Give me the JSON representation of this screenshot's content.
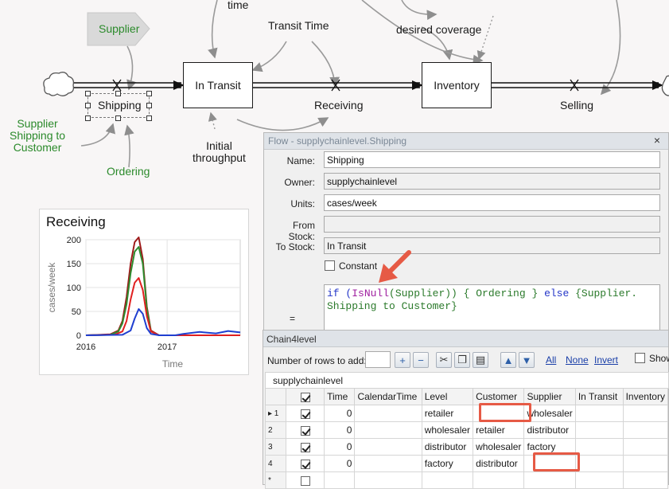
{
  "diagram": {
    "labels": {
      "time": "time",
      "transit_time": "Transit Time",
      "desired_coverage": "desired coverage",
      "supplier": "Supplier",
      "shipping": "Shipping",
      "supplier_shipping_to_customer": [
        "Supplier",
        "Shipping to",
        "Customer"
      ],
      "ordering": "Ordering",
      "initial_throughput": [
        "Initial",
        "throughput"
      ],
      "receiving": "Receiving",
      "selling": "Selling"
    },
    "stocks": {
      "in_transit": "In Transit",
      "inventory": "Inventory"
    }
  },
  "chart_panel": {
    "title": "Receiving"
  },
  "chart_data": {
    "type": "line",
    "title": "Receiving",
    "xlabel": "Time",
    "ylabel": "cases/week",
    "xlim": [
      2016,
      2017.9
    ],
    "ylim": [
      0,
      200
    ],
    "y_ticks": [
      0,
      50,
      100,
      150,
      200
    ],
    "x_ticks": [
      2016,
      2017
    ],
    "grid": true,
    "series": [
      {
        "color": "#9e1a1a",
        "x": [
          2016,
          2016.3,
          2016.4,
          2016.45,
          2016.5,
          2016.55,
          2016.6,
          2016.65,
          2016.7,
          2016.75,
          2016.8,
          2016.9,
          2017.9
        ],
        "y": [
          0,
          2,
          10,
          30,
          80,
          150,
          195,
          205,
          160,
          60,
          10,
          0,
          0
        ]
      },
      {
        "color": "#2e8b2e",
        "x": [
          2016,
          2016.3,
          2016.4,
          2016.45,
          2016.5,
          2016.55,
          2016.6,
          2016.65,
          2016.7,
          2016.75,
          2016.8,
          2016.9,
          2017.9
        ],
        "y": [
          0,
          1,
          8,
          25,
          65,
          130,
          175,
          185,
          150,
          55,
          8,
          0,
          0
        ]
      },
      {
        "color": "#e02020",
        "x": [
          2016,
          2016.35,
          2016.45,
          2016.5,
          2016.55,
          2016.6,
          2016.65,
          2016.7,
          2016.75,
          2016.8,
          2016.9,
          2017.9
        ],
        "y": [
          0,
          1,
          8,
          30,
          75,
          110,
          120,
          95,
          40,
          8,
          0,
          0
        ]
      },
      {
        "color": "#1f3fd0",
        "x": [
          2016,
          2016.45,
          2016.55,
          2016.6,
          2016.65,
          2016.7,
          2016.75,
          2016.8,
          2016.9,
          2017.1,
          2017.2,
          2017.4,
          2017.6,
          2017.75,
          2017.9
        ],
        "y": [
          0,
          1,
          10,
          35,
          55,
          45,
          15,
          3,
          0,
          0,
          3,
          7,
          4,
          9,
          6
        ]
      }
    ]
  },
  "flow_dialog": {
    "title": "Flow - supplychainlevel.Shipping",
    "close_icon": "×",
    "name_label": "Name:",
    "name_value": "Shipping",
    "owner_label": "Owner:",
    "owner_value": "supplychainlevel",
    "units_label": "Units:",
    "units_value": "cases/week",
    "from_stock_label": "From Stock:",
    "from_stock_value": "",
    "to_stock_label": "To Stock:",
    "to_stock_value": "In Transit",
    "constant_label": "Constant",
    "equals_label": "=",
    "code": {
      "t1": "if (",
      "t2": "IsNull",
      "t3": "(Supplier)) { Ordering } ",
      "t4": "else",
      "t5": " {Supplier.",
      "line2": "Shipping to Customer}"
    }
  },
  "table_panel": {
    "title": "Chain4level",
    "rows_to_add_label": "Number of rows to add:",
    "rows_to_add_value": "",
    "link_all": "All",
    "link_none": "None",
    "link_invert": "Invert",
    "show_label": "Show",
    "tab_label": "supplychainlevel",
    "headers": [
      "",
      "",
      "Time",
      "CalendarTime",
      "Level",
      "Customer",
      "Supplier",
      "In Transit",
      "Inventory"
    ],
    "rows": [
      {
        "indicator": "▸ 1",
        "checked": true,
        "time": "0",
        "calendar": "",
        "level": "retailer",
        "customer": "",
        "supplier": "wholesaler",
        "in_transit": "",
        "inventory": ""
      },
      {
        "indicator": "2",
        "checked": true,
        "time": "0",
        "calendar": "",
        "level": "wholesaler",
        "customer": "retailer",
        "supplier": "distributor",
        "in_transit": "",
        "inventory": ""
      },
      {
        "indicator": "3",
        "checked": true,
        "time": "0",
        "calendar": "",
        "level": "distributor",
        "customer": "wholesaler",
        "supplier": "factory",
        "in_transit": "",
        "inventory": ""
      },
      {
        "indicator": "4",
        "checked": true,
        "time": "0",
        "calendar": "",
        "level": "factory",
        "customer": "distributor",
        "supplier": "",
        "in_transit": "",
        "inventory": ""
      },
      {
        "indicator": "*",
        "checked": false,
        "time": "",
        "calendar": "",
        "level": "",
        "customer": "",
        "supplier": "",
        "in_transit": "",
        "inventory": ""
      }
    ]
  },
  "colors": {
    "highlight": "#e65a45",
    "green_label": "#2b8a2b"
  }
}
